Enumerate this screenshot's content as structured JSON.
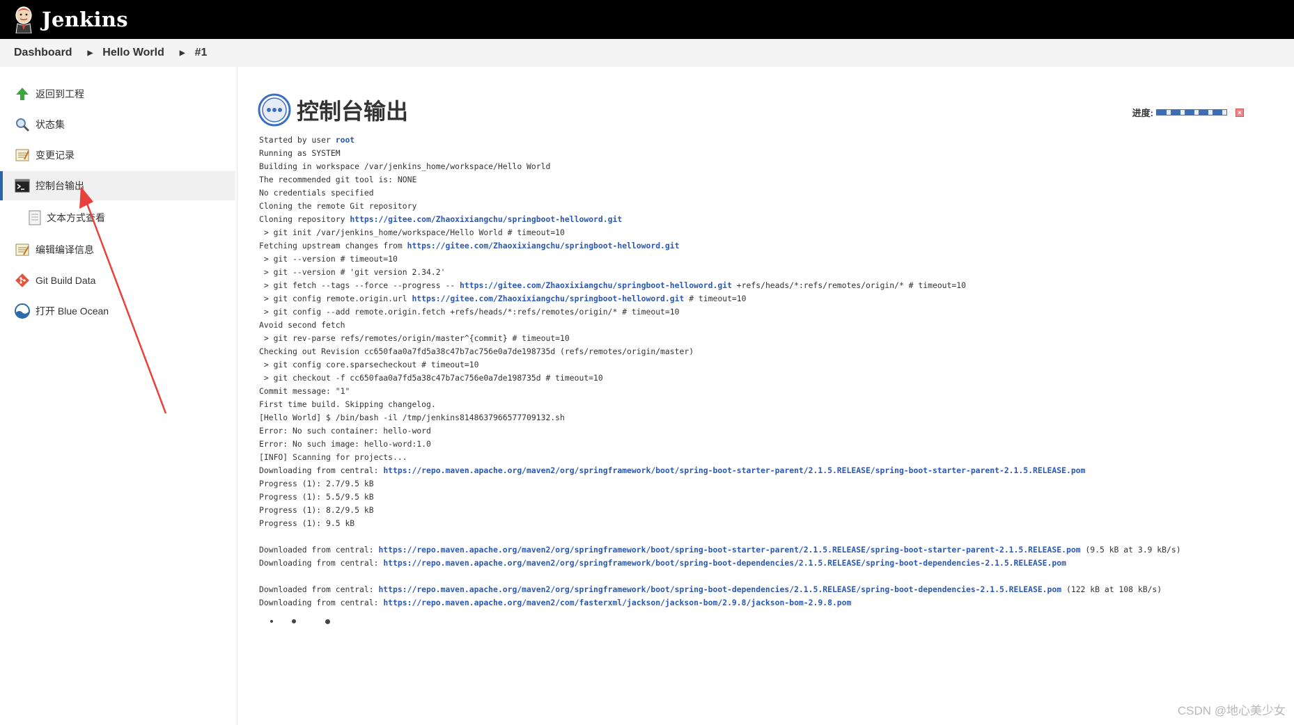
{
  "header": {
    "brand": "Jenkins"
  },
  "breadcrumb": [
    {
      "label": "Dashboard"
    },
    {
      "label": "Hello World"
    },
    {
      "label": "#1"
    }
  ],
  "sidebar": {
    "items": [
      {
        "label": "返回到工程",
        "icon": "up-arrow-icon"
      },
      {
        "label": "状态集",
        "icon": "magnifier-icon"
      },
      {
        "label": "变更记录",
        "icon": "notepad-icon"
      },
      {
        "label": "控制台输出",
        "icon": "terminal-icon",
        "active": true
      },
      {
        "label": "文本方式查看",
        "icon": "document-icon",
        "sub": true
      },
      {
        "label": "编辑编译信息",
        "icon": "notepad-edit-icon"
      },
      {
        "label": "Git Build Data",
        "icon": "git-icon"
      },
      {
        "label": "打开 Blue Ocean",
        "icon": "blue-ocean-icon"
      }
    ]
  },
  "page": {
    "title": "控制台输出",
    "progress_label": "进度:"
  },
  "console": {
    "lines": [
      [
        {
          "t": "Started by user "
        },
        {
          "t": "root",
          "link": true
        }
      ],
      [
        {
          "t": "Running as SYSTEM"
        }
      ],
      [
        {
          "t": "Building in workspace /var/jenkins_home/workspace/Hello World"
        }
      ],
      [
        {
          "t": "The recommended git tool is: NONE"
        }
      ],
      [
        {
          "t": "No credentials specified"
        }
      ],
      [
        {
          "t": "Cloning the remote Git repository"
        }
      ],
      [
        {
          "t": "Cloning repository "
        },
        {
          "t": "https://gitee.com/Zhaoxixiangchu/springboot-helloword.git",
          "link": true
        }
      ],
      [
        {
          "t": " > git init /var/jenkins_home/workspace/Hello World # timeout=10"
        }
      ],
      [
        {
          "t": "Fetching upstream changes from "
        },
        {
          "t": "https://gitee.com/Zhaoxixiangchu/springboot-helloword.git",
          "link": true
        }
      ],
      [
        {
          "t": " > git --version # timeout=10"
        }
      ],
      [
        {
          "t": " > git --version # 'git version 2.34.2'"
        }
      ],
      [
        {
          "t": " > git fetch --tags --force --progress -- "
        },
        {
          "t": "https://gitee.com/Zhaoxixiangchu/springboot-helloword.git",
          "link": true
        },
        {
          "t": " +refs/heads/*:refs/remotes/origin/* # timeout=10"
        }
      ],
      [
        {
          "t": " > git config remote.origin.url "
        },
        {
          "t": "https://gitee.com/Zhaoxixiangchu/springboot-helloword.git",
          "link": true
        },
        {
          "t": " # timeout=10"
        }
      ],
      [
        {
          "t": " > git config --add remote.origin.fetch +refs/heads/*:refs/remotes/origin/* # timeout=10"
        }
      ],
      [
        {
          "t": "Avoid second fetch"
        }
      ],
      [
        {
          "t": " > git rev-parse refs/remotes/origin/master^{commit} # timeout=10"
        }
      ],
      [
        {
          "t": "Checking out Revision cc650faa0a7fd5a38c47b7ac756e0a7de198735d (refs/remotes/origin/master)"
        }
      ],
      [
        {
          "t": " > git config core.sparsecheckout # timeout=10"
        }
      ],
      [
        {
          "t": " > git checkout -f cc650faa0a7fd5a38c47b7ac756e0a7de198735d # timeout=10"
        }
      ],
      [
        {
          "t": "Commit message: \"1\""
        }
      ],
      [
        {
          "t": "First time build. Skipping changelog."
        }
      ],
      [
        {
          "t": "[Hello World] $ /bin/bash -il /tmp/jenkins8148637966577709132.sh"
        }
      ],
      [
        {
          "t": "Error: No such container: hello-word"
        }
      ],
      [
        {
          "t": "Error: No such image: hello-word:1.0"
        }
      ],
      [
        {
          "t": "[INFO] Scanning for projects..."
        }
      ],
      [
        {
          "t": "Downloading from central: "
        },
        {
          "t": "https://repo.maven.apache.org/maven2/org/springframework/boot/spring-boot-starter-parent/2.1.5.RELEASE/spring-boot-starter-parent-2.1.5.RELEASE.pom",
          "link": true
        }
      ],
      [
        {
          "t": "Progress (1): 2.7/9.5 kB"
        }
      ],
      [
        {
          "t": "Progress (1): 5.5/9.5 kB"
        }
      ],
      [
        {
          "t": "Progress (1): 8.2/9.5 kB"
        }
      ],
      [
        {
          "t": "Progress (1): 9.5 kB"
        }
      ],
      [
        {
          "t": ""
        }
      ],
      [
        {
          "t": "Downloaded from central: "
        },
        {
          "t": "https://repo.maven.apache.org/maven2/org/springframework/boot/spring-boot-starter-parent/2.1.5.RELEASE/spring-boot-starter-parent-2.1.5.RELEASE.pom",
          "link": true
        },
        {
          "t": " (9.5 kB at 3.9 kB/s)"
        }
      ],
      [
        {
          "t": "Downloading from central: "
        },
        {
          "t": "https://repo.maven.apache.org/maven2/org/springframework/boot/spring-boot-dependencies/2.1.5.RELEASE/spring-boot-dependencies-2.1.5.RELEASE.pom",
          "link": true
        }
      ],
      [
        {
          "t": ""
        }
      ],
      [
        {
          "t": "Downloaded from central: "
        },
        {
          "t": "https://repo.maven.apache.org/maven2/org/springframework/boot/spring-boot-dependencies/2.1.5.RELEASE/spring-boot-dependencies-2.1.5.RELEASE.pom",
          "link": true
        },
        {
          "t": " (122 kB at 108 kB/s)"
        }
      ],
      [
        {
          "t": "Downloading from central: "
        },
        {
          "t": "https://repo.maven.apache.org/maven2/com/fasterxml/jackson/jackson-bom/2.9.8/jackson-bom-2.9.8.pom",
          "link": true
        }
      ]
    ]
  },
  "watermark": "CSDN @地心美少女",
  "colors": {
    "header_bg": "#000000",
    "link": "#2a58b4",
    "active_border": "#2b64a8",
    "annotation_arrow": "#e8403a"
  }
}
